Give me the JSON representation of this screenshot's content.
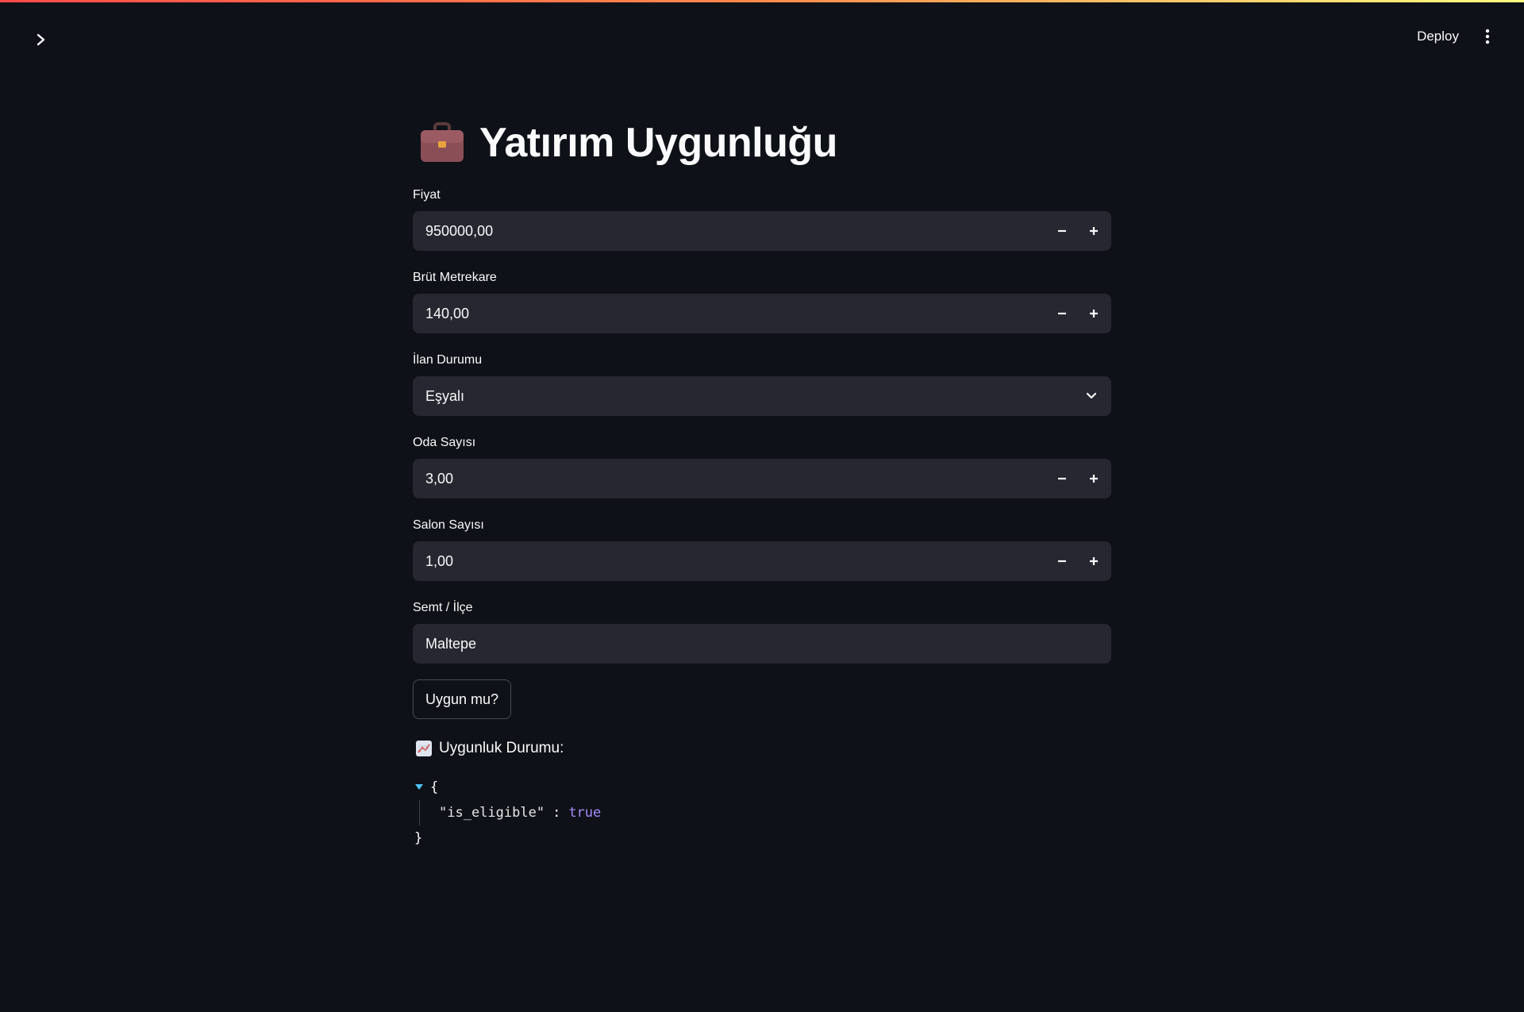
{
  "header": {
    "deploy_label": "Deploy",
    "sidebar_toggle_icon": "chevron-right-icon",
    "menu_icon": "vertical-ellipsis-icon"
  },
  "page": {
    "title_icon": "briefcase-icon",
    "title": "Yatırım Uygunluğu"
  },
  "form": {
    "price": {
      "label": "Fiyat",
      "value": "950000,00"
    },
    "gross_area": {
      "label": "Brüt Metrekare",
      "value": "140,00"
    },
    "listing_status": {
      "label": "İlan Durumu",
      "value": "Eşyalı"
    },
    "room_count": {
      "label": "Oda Sayısı",
      "value": "3,00"
    },
    "salon_count": {
      "label": "Salon Sayısı",
      "value": "1,00"
    },
    "district": {
      "label": "Semt / İlçe",
      "value": "Maltepe"
    },
    "submit_label": "Uygun mu?"
  },
  "result": {
    "heading_icon": "chart-increasing-icon",
    "heading": "Uygunluk Durumu:",
    "json_open": "{",
    "json_close": "}",
    "json_key": "\"is_eligible\"",
    "json_colon": ":",
    "json_value": "true"
  },
  "colors": {
    "background": "#0e1117",
    "input_bg": "#262730",
    "accent_bool": "#a78bfa",
    "caret": "#4fc3f7"
  }
}
